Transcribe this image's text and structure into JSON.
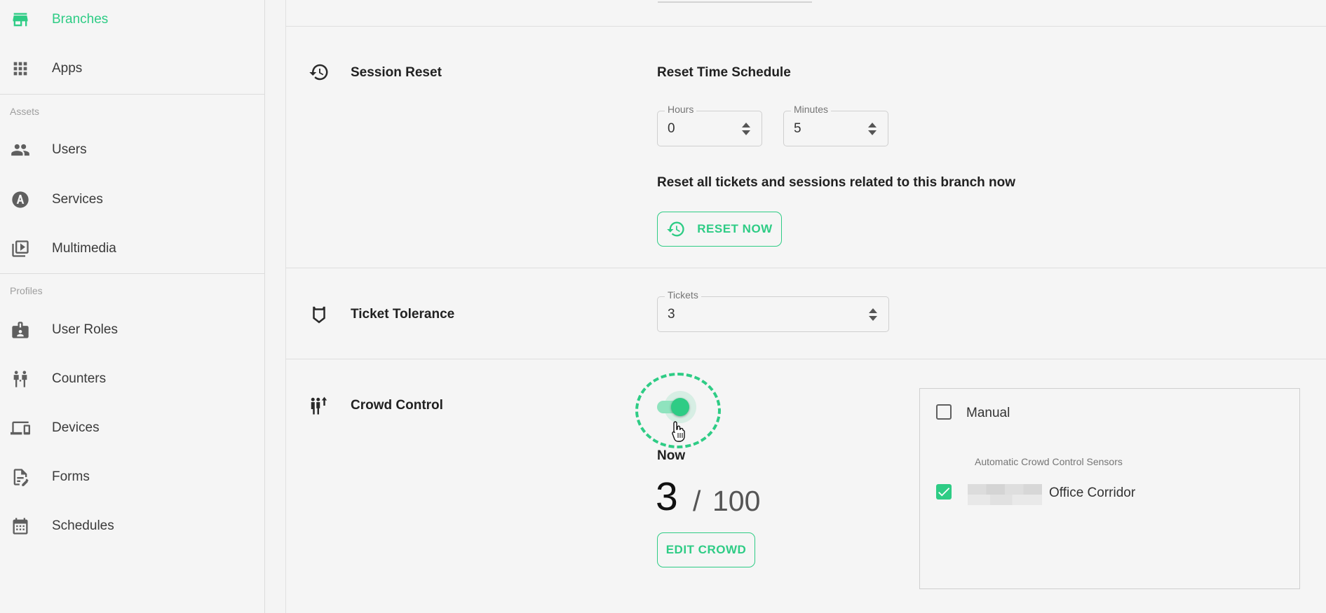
{
  "sidebar": {
    "items": [
      {
        "label": "Branches",
        "icon": "store-icon",
        "active": true
      },
      {
        "label": "Apps",
        "icon": "apps-grid-icon"
      },
      {
        "label": "Users",
        "icon": "people-icon"
      },
      {
        "label": "Services",
        "icon": "service-a-icon"
      },
      {
        "label": "Multimedia",
        "icon": "multimedia-icon"
      },
      {
        "label": "User Roles",
        "icon": "badge-icon"
      },
      {
        "label": "Counters",
        "icon": "counters-icon"
      },
      {
        "label": "Devices",
        "icon": "devices-icon"
      },
      {
        "label": "Forms",
        "icon": "form-icon"
      },
      {
        "label": "Schedules",
        "icon": "calendar-icon"
      }
    ],
    "sections": {
      "assets": "Assets",
      "profiles": "Profiles"
    }
  },
  "session_reset": {
    "title": "Session Reset",
    "schedule_title": "Reset Time Schedule",
    "hours": {
      "label": "Hours",
      "value": "0"
    },
    "minutes": {
      "label": "Minutes",
      "value": "5"
    },
    "reset_all_text": "Reset all tickets and sessions related to this branch now",
    "reset_button": "RESET NOW"
  },
  "ticket_tolerance": {
    "title": "Ticket Tolerance",
    "tickets": {
      "label": "Tickets",
      "value": "3"
    }
  },
  "crowd_control": {
    "title": "Crowd Control",
    "enabled": true,
    "now_label": "Now",
    "current": "3",
    "slash": "/",
    "max": "100",
    "edit_button": "EDIT CROWD",
    "manual_label": "Manual",
    "manual_checked": false,
    "sensors_legend": "Automatic Crowd Control Sensors",
    "sensors": [
      {
        "name": "Office Corridor",
        "checked": true
      }
    ]
  },
  "colors": {
    "accent": "#2ecc85",
    "text": "#212121",
    "muted": "#757575"
  }
}
